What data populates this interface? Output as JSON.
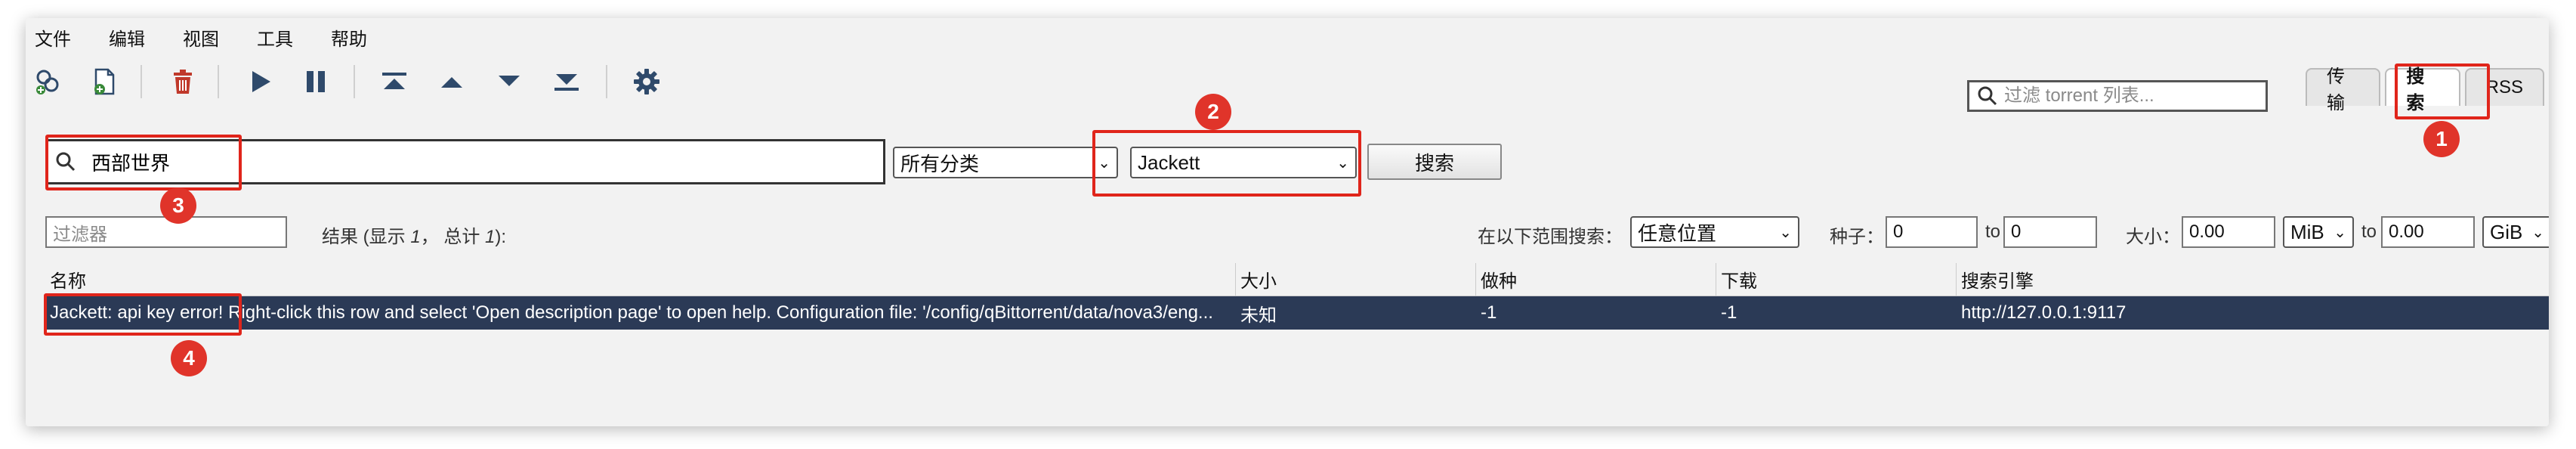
{
  "menu": {
    "items": [
      "文件",
      "编辑",
      "视图",
      "工具",
      "帮助"
    ]
  },
  "toolbar": {
    "icons": [
      "add-torrent-link-icon",
      "add-torrent-file-icon",
      "delete-icon",
      "resume-icon",
      "pause-icon",
      "move-top-icon",
      "move-up-icon",
      "move-down-icon",
      "move-bottom-icon",
      "settings-icon"
    ],
    "filter_placeholder": "过滤 torrent 列表..."
  },
  "tabs": [
    {
      "label": "传输",
      "active": false
    },
    {
      "label": "搜索",
      "active": true
    },
    {
      "label": "RSS",
      "active": false
    }
  ],
  "search": {
    "query": "西部世界",
    "category": "所有分类",
    "plugin": "Jackett",
    "button_label": "搜索"
  },
  "filter_row": {
    "filter_placeholder": "过滤器",
    "results_prefix": "结果 (显示 ",
    "results_shown": "1",
    "results_mid": "， 总计 ",
    "results_total": "1",
    "results_suffix": "):",
    "search_in_label": "在以下范围搜索：",
    "search_in_value": "任意位置",
    "seeds_label": "种子：",
    "seeds_min": "0",
    "to_label": "to",
    "seeds_max": "0",
    "size_label": "大小：",
    "size_min": "0.00",
    "size_min_unit": "MiB",
    "size_max": "0.00",
    "size_max_unit": "GiB"
  },
  "table": {
    "headers": [
      "名称",
      "大小",
      "做种",
      "下载",
      "搜索引擎"
    ],
    "rows": [
      {
        "name": "Jackett: api key error! Right-click this row and select 'Open description page' to open help. Configuration file: '/config/qBittorrent/data/nova3/eng...",
        "size": "未知",
        "seeds": "-1",
        "leechers": "-1",
        "engine": "http://127.0.0.1:9117"
      }
    ]
  },
  "annotations": {
    "badges": [
      "1",
      "2",
      "3",
      "4"
    ],
    "color": "#e0251b"
  },
  "colors": {
    "selected_row": "#2b3a56",
    "delete_icon": "#c0392b",
    "toolbar_icon": "#2f4a6b"
  }
}
